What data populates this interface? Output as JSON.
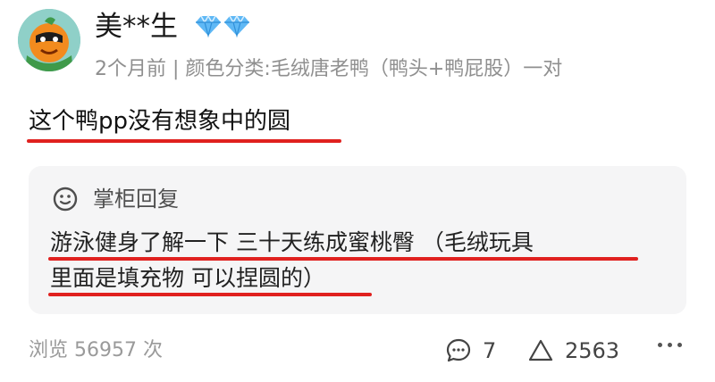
{
  "user": {
    "name": "美**生",
    "avatar_icon": "orange-cartoon-avatar",
    "badge_icon": "diamond-icon",
    "badge_color": "#4aa9f2"
  },
  "meta": {
    "time": "2个月前",
    "separator": "|",
    "variant": "颜色分类:毛绒唐老鸭（鸭头+鸭屁股）一对"
  },
  "comment": {
    "text": "这个鸭pp没有想象中的圆"
  },
  "reply": {
    "icon": "smile-icon",
    "title": "掌柜回复",
    "lines": [
      "游泳健身了解一下  三十天练成蜜桃臀  （毛绒玩具",
      "里面是填充物 可以捏圆的）"
    ]
  },
  "footer": {
    "views_label": "浏览 56957 次",
    "comment_icon": "comment-bubble-icon",
    "comment_count": "7",
    "like_icon": "triangle-up-icon",
    "like_count": "2563",
    "more_icon": "more-dots-icon"
  },
  "colors": {
    "highlight_underline": "#e0211f",
    "reply_background": "#f5f5f6",
    "meta_text": "#8f8f8f"
  }
}
